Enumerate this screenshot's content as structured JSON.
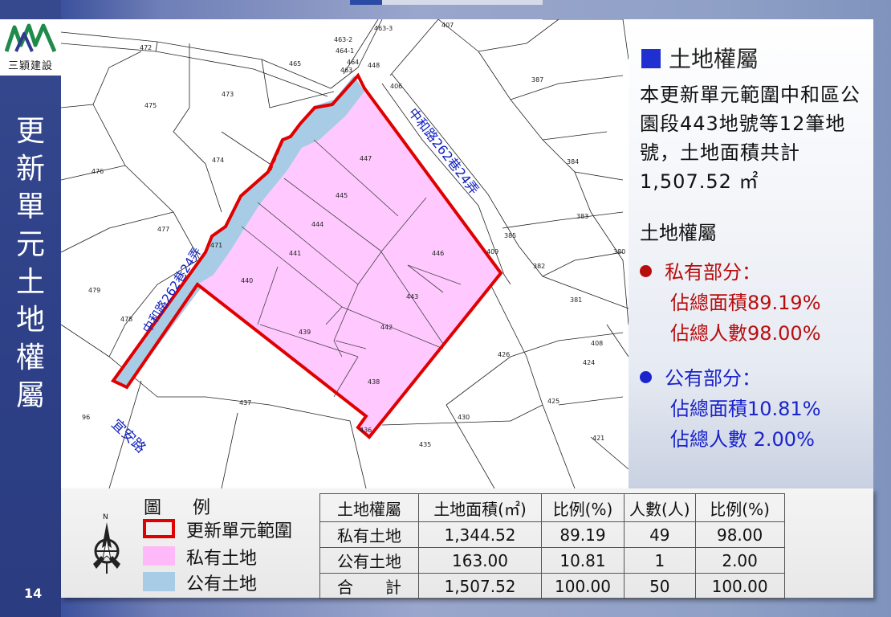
{
  "logo": {
    "brand": "三穎建設"
  },
  "slide": {
    "title_chars": [
      "更",
      "新",
      "單",
      "元",
      "土",
      "地",
      "權",
      "屬"
    ],
    "page_number": "14"
  },
  "map": {
    "road_labels": {
      "road1": "中和路262巷24弄",
      "road2": "中和路262巷24弄",
      "road3": "宜安路"
    },
    "parcels": [
      "407",
      "463-3",
      "463-2",
      "464-1",
      "464",
      "463",
      "448",
      "472",
      "465",
      "406",
      "387",
      "475",
      "473",
      "476",
      "474",
      "447",
      "384",
      "445",
      "383",
      "477",
      "444",
      "385",
      "446",
      "409",
      "441",
      "380",
      "382",
      "471",
      "440",
      "443",
      "381",
      "479",
      "478",
      "442",
      "439",
      "408",
      "426",
      "424",
      "438",
      "437",
      "425",
      "96",
      "430",
      "436",
      "435",
      "421"
    ]
  },
  "info": {
    "heading": "土地權屬",
    "body": "本更新單元範圍中和區公園段443地號等12筆地號，土地面積共計1,507.52 ㎡",
    "subheading": "土地權屬",
    "private": {
      "label": "私有部分：",
      "area": "佔總面積89.19%",
      "people": "佔總人數98.00%"
    },
    "public": {
      "label": "公有部分：",
      "area": "佔總面積10.81%",
      "people": "佔總人數 2.00%"
    }
  },
  "legend": {
    "title": "圖 例",
    "items": [
      {
        "label": "更新單元範圍"
      },
      {
        "label": "私有土地"
      },
      {
        "label": "公有土地"
      }
    ],
    "north_label": "N"
  },
  "table": {
    "headers": [
      "土地權屬",
      "土地面積(㎡)",
      "比例(%)",
      "人數(人)",
      "比例(%)"
    ],
    "rows": [
      [
        "私有土地",
        "1,344.52",
        "89.19",
        "49",
        "98.00"
      ],
      [
        "公有土地",
        "163.00",
        "10.81",
        "1",
        "2.00"
      ],
      [
        "合　　計",
        "1,507.52",
        "100.00",
        "50",
        "100.00"
      ]
    ]
  },
  "colors": {
    "boundary": "#e00000",
    "private_fill": "#ffc8ff",
    "public_fill": "#a8cce6",
    "road_text": "#1020c0",
    "heading_square": "#1f2fd0",
    "private_text": "#b80d0d",
    "public_text": "#1a23cc"
  }
}
